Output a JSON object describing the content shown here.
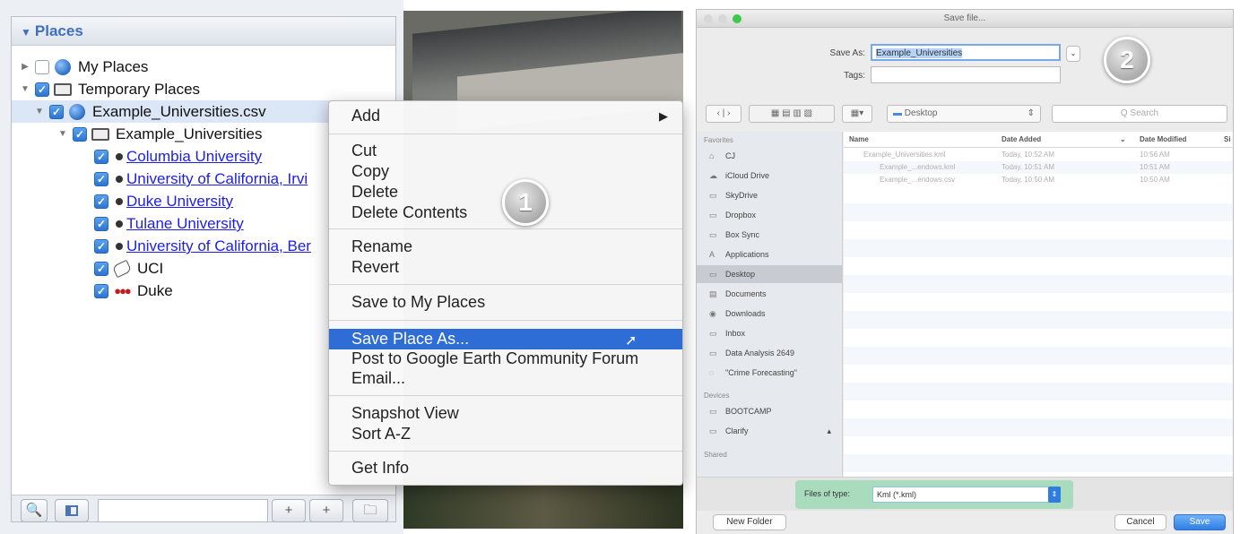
{
  "places": {
    "title": "Places",
    "items": [
      {
        "label": "My Places"
      },
      {
        "label": "Temporary Places"
      },
      {
        "label": "Example_Universities.csv"
      },
      {
        "label": "Example_Universities"
      },
      {
        "label": "Columbia University"
      },
      {
        "label": "University of California, Irvi"
      },
      {
        "label": "Duke University"
      },
      {
        "label": "Tulane University"
      },
      {
        "label": "University of California, Ber"
      },
      {
        "label": "UCI"
      },
      {
        "label": "Duke"
      }
    ]
  },
  "bottom_bar": {
    "search_icon": "🔍",
    "add_icon": "+",
    "move_icon": "+",
    "folder_icon": "🗀"
  },
  "context_menu": {
    "items": [
      {
        "label": "Add",
        "arrow": "▶"
      },
      {
        "label": "Cut"
      },
      {
        "label": "Copy"
      },
      {
        "label": "Delete"
      },
      {
        "label": "Delete Contents"
      },
      {
        "label": "Rename"
      },
      {
        "label": "Revert"
      },
      {
        "label": "Save to My Places"
      },
      {
        "label": "Save Place As..."
      },
      {
        "label": "Post to Google Earth Community Forum"
      },
      {
        "label": "Email..."
      },
      {
        "label": "Snapshot View"
      },
      {
        "label": "Sort A-Z"
      },
      {
        "label": "Get Info"
      }
    ]
  },
  "callouts": {
    "one": "1",
    "two": "2"
  },
  "save_dialog": {
    "title": "Save file...",
    "save_as_label": "Save As:",
    "save_as_value": "Example_Universities",
    "tags_label": "Tags:",
    "location": "Desktop",
    "search_placeholder": "Q Search",
    "sidebar": {
      "favorites_header": "Favorites",
      "favorites": [
        {
          "label": "CJ",
          "icon": "⌂"
        },
        {
          "label": "iCloud Drive",
          "icon": "☁"
        },
        {
          "label": "SkyDrive",
          "icon": "▭"
        },
        {
          "label": "Dropbox",
          "icon": "▭"
        },
        {
          "label": "Box Sync",
          "icon": "▭"
        },
        {
          "label": "Applications",
          "icon": "A"
        },
        {
          "label": "Desktop",
          "icon": "▭"
        },
        {
          "label": "Documents",
          "icon": "▤"
        },
        {
          "label": "Downloads",
          "icon": "◉"
        },
        {
          "label": "Inbox",
          "icon": "▭"
        },
        {
          "label": "Data Analysis 2649",
          "icon": "▭"
        },
        {
          "label": "\"Crime Forecasting\"",
          "icon": "◌"
        }
      ],
      "devices_header": "Devices",
      "devices": [
        {
          "label": "BOOTCAMP",
          "icon": "▭"
        },
        {
          "label": "Clarify",
          "icon": "▭"
        }
      ],
      "shared_header": "Shared"
    },
    "columns": {
      "name": "Name",
      "date_added": "Date Added",
      "date_modified": "Date Modified",
      "size": "Si"
    },
    "files": [
      {
        "name": "Example_Universities.kml",
        "added": "Today, 10:52 AM",
        "modified": "10:56 AM"
      },
      {
        "name": "Example_...endows.kml",
        "added": "Today, 10:51 AM",
        "modified": "10:51 AM"
      },
      {
        "name": "Example_...endows.csv",
        "added": "Today, 10:50 AM",
        "modified": "10:50 AM"
      }
    ],
    "files_of_type_label": "Files of type:",
    "files_of_type_value": "Kml (*.kml)",
    "new_folder": "New Folder",
    "cancel": "Cancel",
    "save": "Save"
  }
}
